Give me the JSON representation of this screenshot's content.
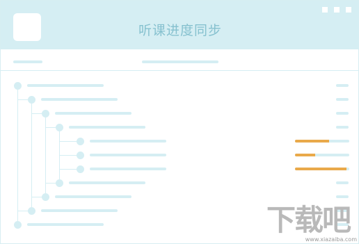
{
  "header": {
    "title": "听课进度同步",
    "window_controls": [
      "minimize",
      "maximize",
      "close"
    ]
  },
  "tree": {
    "nodes": [
      {
        "level": 0
      },
      {
        "level": 1
      },
      {
        "level": 2
      },
      {
        "level": 3
      },
      {
        "level": 4,
        "progress": 0.63
      },
      {
        "level": 4,
        "progress": 0.37
      },
      {
        "level": 4,
        "progress": 0.95
      },
      {
        "level": 3
      },
      {
        "level": 2
      },
      {
        "level": 1
      },
      {
        "level": 0
      }
    ]
  },
  "colors": {
    "header_bg": "#d5eef3",
    "placeholder": "#d5eef3",
    "progress_fill": "#e9a94a",
    "title_text": "#86c1cf"
  },
  "watermark": {
    "text": "下载吧",
    "url": "www.xiazaiba.com"
  }
}
